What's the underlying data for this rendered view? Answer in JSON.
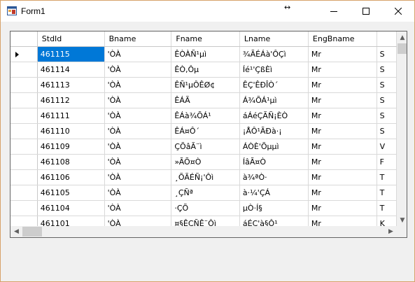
{
  "window": {
    "title": "Form1",
    "move_glyph": "↔",
    "controls": {
      "minimize": "minimize",
      "maximize": "maximize",
      "close": "close"
    }
  },
  "grid": {
    "columns": [
      "StdId",
      "Bname",
      "Fname",
      "Lname",
      "EngBname",
      ""
    ],
    "selected_row": 0,
    "rows": [
      [
        "461115",
        "'ÒÀ",
        "ÊÒÀÑ¹µì",
        "¾ÃÉÁà'ÔÇì",
        "Mr",
        "S"
      ],
      [
        "461114",
        "'ÒÀ",
        "ÊÒ,Ôµ",
        "Íé¹'ÇßÈì",
        "Mr",
        "S"
      ],
      [
        "461113",
        "'ÒÀ",
        "ÊÑ¹µÔÊØ¢",
        "ÊÇ'ÊÐÎÒ´",
        "Mr",
        "S"
      ],
      [
        "461112",
        "'ÒÀ",
        "ÊÁÃ",
        "Á¾ÕÁ¹µì",
        "Mr",
        "S"
      ],
      [
        "461111",
        "'ÒÀ",
        "ÊÁà¾ÕÁ¹",
        "áÁéÇÃÑ¡ÈÒ",
        "Mr",
        "S"
      ],
      [
        "461110",
        "'ÒÀ",
        "ÊÁ¤Ô´",
        "¡ÅÔ¹ÃÐà·¡",
        "Mr",
        "S"
      ],
      [
        "461109",
        "'ÒÀ",
        "ÇÕâÃ¨ì",
        "ÁÒÈ'Õµµì",
        "Mr",
        "V"
      ],
      [
        "461108",
        "'ÒÀ",
        "»ÃÕ¤Ò",
        "ÍâÃ¤Ò",
        "Mr",
        "F"
      ],
      [
        "461106",
        "'ÒÀ",
        "¸ÕÃÉÑ¡'Ôì",
        "à¾ªÒ·",
        "Mr",
        "T"
      ],
      [
        "461105",
        "'ÒÀ",
        "¸ÇÑª",
        "à·¼'ÇÁ",
        "Mr",
        "T"
      ],
      [
        "461104",
        "'ÒÀ",
        "·ÇÕ",
        "µÒ·Í§",
        "Mr",
        "T"
      ],
      [
        "461101",
        "'ÒÀ",
        "¤§ÊÇÑÊ¨Ôì",
        "áÉC'à§Ô¹",
        "Mr",
        "K"
      ]
    ]
  },
  "icons": {
    "app": "form-app-icon",
    "row_pointer": "row-pointer-icon"
  },
  "colors": {
    "selection": "#0078d7",
    "window_border": "#d7a26a",
    "form_background": "#f0f0f0"
  }
}
